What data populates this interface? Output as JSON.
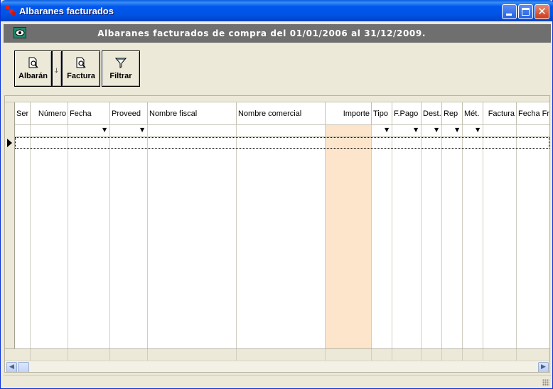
{
  "window": {
    "title": "Albaranes facturados",
    "colors": {
      "titlebar": "#0058ee",
      "banner": "#6f6f6f",
      "highlight_column": "#fce5cb"
    }
  },
  "banner": {
    "text": "Albaranes facturados de compra del 01/01/2006 al 31/12/2009.",
    "icon": "eye-icon"
  },
  "toolbar": {
    "albaran_label": "Albarán",
    "factura_label": "Factura",
    "filtrar_label": "Filtrar",
    "albaran_icon": "magnifier-document-icon",
    "factura_icon": "magnifier-document-icon",
    "filtrar_icon": "funnel-icon"
  },
  "grid": {
    "columns": [
      {
        "label": "Ser",
        "align": "left"
      },
      {
        "label": "Número",
        "align": "right"
      },
      {
        "label": "Fecha",
        "align": "left"
      },
      {
        "label": "Proveed",
        "align": "left"
      },
      {
        "label": "Nombre fiscal",
        "align": "left"
      },
      {
        "label": "Nombre comercial",
        "align": "left"
      },
      {
        "label": "Importe",
        "align": "right"
      },
      {
        "label": "Tipo",
        "align": "left"
      },
      {
        "label": "F.Pago",
        "align": "left"
      },
      {
        "label": "Dest.",
        "align": "left"
      },
      {
        "label": "Rep",
        "align": "left"
      },
      {
        "label": "Mét.",
        "align": "left"
      },
      {
        "label": "Factura",
        "align": "right"
      },
      {
        "label": "Fecha Fr",
        "align": "left"
      }
    ],
    "rows": []
  }
}
